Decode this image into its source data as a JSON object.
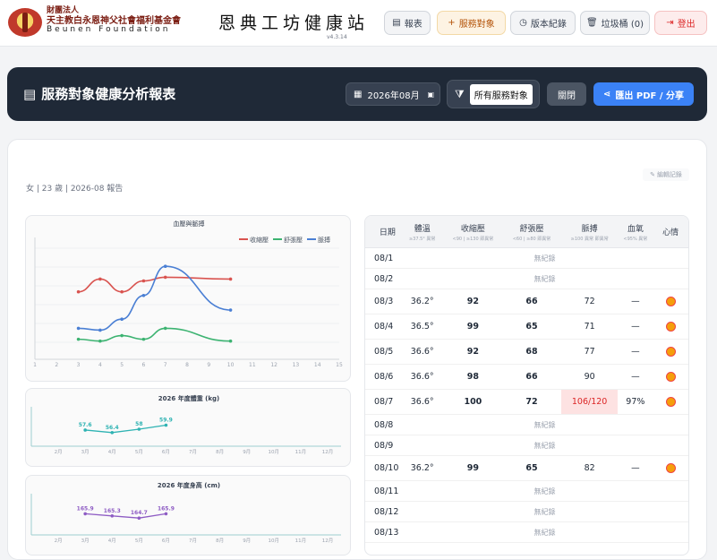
{
  "org": {
    "line1": "財團法人",
    "line2": "天主教白永恩神父社會福利基金會",
    "line3": "Beunen Foundation"
  },
  "brand": {
    "title": "恩典工坊健康站",
    "version": "v4.3.14"
  },
  "nav": {
    "report": "報表",
    "clients": "服務對象",
    "version": "版本紀錄",
    "trash": "垃圾桶 (0)",
    "logout": "登出"
  },
  "header": {
    "title": "服務對象健康分析報表",
    "month": "2026年08月",
    "filter": "所有服務對象",
    "close": "關閉",
    "export": "匯出 PDF / 分享"
  },
  "report": {
    "subtitle": "女 | 23 歲 | 2026-08 報告",
    "edit": "編輯記錄"
  },
  "chart_data": [
    {
      "type": "line",
      "title": "血壓與脈搏",
      "x": [
        3,
        4,
        5,
        6,
        7,
        8,
        9,
        10
      ],
      "xlim": [
        1,
        15
      ],
      "xticks": [
        "1",
        "2",
        "3",
        "4",
        "5",
        "6",
        "7",
        "8",
        "9",
        "10",
        "11",
        "12",
        "13",
        "14",
        "15"
      ],
      "series": [
        {
          "name": "收縮壓",
          "color": "#d9534f",
          "x": [
            3,
            4,
            5,
            6,
            7,
            10
          ],
          "values": [
            92,
            99,
            92,
            98,
            100,
            99
          ]
        },
        {
          "name": "舒張壓",
          "color": "#3cb371",
          "x": [
            3,
            4,
            5,
            6,
            7,
            10
          ],
          "values": [
            66,
            65,
            68,
            66,
            72,
            65
          ]
        },
        {
          "name": "脈搏",
          "color": "#4a7fd4",
          "x": [
            3,
            4,
            5,
            6,
            7,
            10
          ],
          "values": [
            72,
            71,
            77,
            90,
            106,
            82
          ]
        }
      ]
    },
    {
      "type": "line",
      "title": "2026 年度體重 (kg)",
      "categories": [
        "2月",
        "3月",
        "4月",
        "5月",
        "6月",
        "7月",
        "8月",
        "9月",
        "10月",
        "11月",
        "12月"
      ],
      "series": [
        {
          "name": "",
          "color": "#2fb3b3",
          "x": [
            "3月",
            "4月",
            "5月",
            "6月"
          ],
          "values": [
            57.6,
            56.4,
            58,
            59.9
          ]
        }
      ]
    },
    {
      "type": "line",
      "title": "2026 年度身高 (cm)",
      "categories": [
        "2月",
        "3月",
        "4月",
        "5月",
        "6月",
        "7月",
        "8月",
        "9月",
        "10月",
        "11月",
        "12月"
      ],
      "series": [
        {
          "name": "",
          "color": "#8e5cc4",
          "x": [
            "3月",
            "4月",
            "5月",
            "6月"
          ],
          "values": [
            165.9,
            165.3,
            164.7,
            165.9
          ]
        }
      ]
    }
  ],
  "table": {
    "headers": [
      {
        "label": "日期",
        "sub": ""
      },
      {
        "label": "體溫",
        "sub": "≥37.5° 異常"
      },
      {
        "label": "收縮壓",
        "sub": "<90 | ≥130 即異常"
      },
      {
        "label": "舒張壓",
        "sub": "<60 | ≥80 即異常"
      },
      {
        "label": "脈搏",
        "sub": "≥100 異常 即異常"
      },
      {
        "label": "血氧",
        "sub": "<95% 異常"
      },
      {
        "label": "心情",
        "sub": ""
      }
    ],
    "empty_text": "無紀錄",
    "rows": [
      {
        "date": "08/1",
        "empty": true
      },
      {
        "date": "08/2",
        "empty": true
      },
      {
        "date": "08/3",
        "temp": "36.2°",
        "sys": "92",
        "dia": "66",
        "pulse": "72",
        "spo2": "—"
      },
      {
        "date": "08/4",
        "temp": "36.5°",
        "sys": "99",
        "dia": "65",
        "pulse": "71",
        "spo2": "—"
      },
      {
        "date": "08/5",
        "temp": "36.6°",
        "sys": "92",
        "dia": "68",
        "pulse": "77",
        "spo2": "—"
      },
      {
        "date": "08/6",
        "temp": "36.6°",
        "sys": "98",
        "dia": "66",
        "pulse": "90",
        "spo2": "—"
      },
      {
        "date": "08/7",
        "temp": "36.6°",
        "sys": "100",
        "dia": "72",
        "pulse": "106/120",
        "spo2": "97%",
        "alert": true
      },
      {
        "date": "08/8",
        "empty": true
      },
      {
        "date": "08/9",
        "empty": true
      },
      {
        "date": "08/10",
        "temp": "36.2°",
        "sys": "99",
        "dia": "65",
        "pulse": "82",
        "spo2": "—"
      },
      {
        "date": "08/11",
        "empty": true
      },
      {
        "date": "08/12",
        "empty": true
      },
      {
        "date": "08/13",
        "empty": true
      }
    ]
  }
}
